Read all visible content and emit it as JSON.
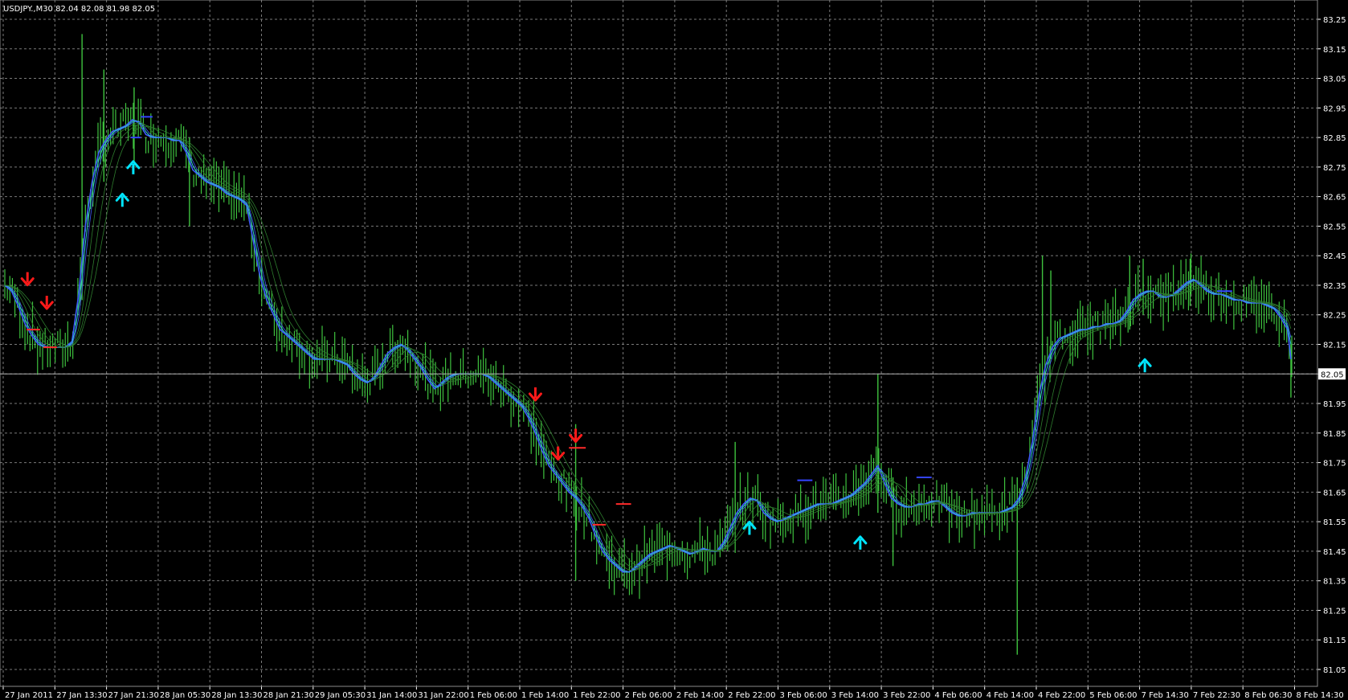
{
  "window": {
    "symbol_label": "USDJPY.,M30",
    "ohlc_label": "82.04 82.08 81.98 82.05",
    "current_price_label": "82.05"
  },
  "colors": {
    "background": "#000000",
    "grid": "#7a7a7a",
    "bars": "#3ec23e",
    "ma_blue": "#3f5cff",
    "ma_cyan": "#2fd0d0",
    "ma_green": "#2e7d2e",
    "arrow_up": "#00e5ff",
    "arrow_down": "#ff1a1a",
    "level_red": "#ff2a2a",
    "level_blue": "#3344ff",
    "axis_text": "#ffffff",
    "price_line": "#b0b0b0"
  },
  "price_axis": {
    "ticks": [
      "83.25",
      "83.15",
      "83.05",
      "82.95",
      "82.85",
      "82.75",
      "82.65",
      "82.55",
      "82.45",
      "82.35",
      "82.25",
      "82.15",
      "82.05",
      "81.95",
      "81.85",
      "81.75",
      "81.65",
      "81.55",
      "81.45",
      "81.35",
      "81.25",
      "81.15",
      "81.05"
    ]
  },
  "time_axis": {
    "ticks": [
      "27 Jan 2011",
      "27 Jan 13:30",
      "27 Jan 21:30",
      "28 Jan 05:30",
      "28 Jan 13:30",
      "28 Jan 21:30",
      "29 Jan 05:30",
      "31 Jan 14:00",
      "31 Jan 22:00",
      "1 Feb 06:00",
      "1 Feb 14:00",
      "1 Feb 22:00",
      "2 Feb 06:00",
      "2 Feb 14:00",
      "2 Feb 22:00",
      "3 Feb 06:00",
      "3 Feb 14:00",
      "3 Feb 22:00",
      "4 Feb 06:00",
      "4 Feb 14:00",
      "4 Feb 22:00",
      "5 Feb 06:00",
      "7 Feb 14:30",
      "7 Feb 22:30",
      "8 Feb 06:30",
      "8 Feb 14:30"
    ]
  },
  "chart_data": {
    "type": "bar",
    "title": "USDJPY.,M30",
    "ylim": [
      81.0,
      83.3
    ],
    "current_price": 82.05,
    "series_path": [
      [
        0,
        82.35
      ],
      [
        8,
        82.33
      ],
      [
        16,
        82.28
      ],
      [
        24,
        82.22
      ],
      [
        32,
        82.18
      ],
      [
        40,
        82.15
      ],
      [
        48,
        82.14
      ],
      [
        56,
        82.14
      ],
      [
        64,
        82.14
      ],
      [
        72,
        82.14
      ],
      [
        80,
        82.16
      ],
      [
        88,
        82.32
      ],
      [
        96,
        82.55
      ],
      [
        104,
        82.7
      ],
      [
        112,
        82.8
      ],
      [
        120,
        82.84
      ],
      [
        128,
        82.87
      ],
      [
        136,
        82.88
      ],
      [
        144,
        82.89
      ],
      [
        152,
        82.91
      ],
      [
        160,
        82.9
      ],
      [
        168,
        82.86
      ],
      [
        176,
        82.85
      ],
      [
        184,
        82.85
      ],
      [
        192,
        82.85
      ],
      [
        200,
        82.84
      ],
      [
        208,
        82.84
      ],
      [
        216,
        82.8
      ],
      [
        224,
        82.74
      ],
      [
        232,
        82.72
      ],
      [
        240,
        82.7
      ],
      [
        248,
        82.69
      ],
      [
        256,
        82.68
      ],
      [
        264,
        82.66
      ],
      [
        272,
        82.65
      ],
      [
        280,
        82.64
      ],
      [
        288,
        82.62
      ],
      [
        296,
        82.5
      ],
      [
        304,
        82.38
      ],
      [
        312,
        82.3
      ],
      [
        320,
        82.25
      ],
      [
        328,
        82.2
      ],
      [
        336,
        82.18
      ],
      [
        344,
        82.16
      ],
      [
        352,
        82.14
      ],
      [
        360,
        82.12
      ],
      [
        368,
        82.1
      ],
      [
        376,
        82.1
      ],
      [
        384,
        82.1
      ],
      [
        392,
        82.1
      ],
      [
        400,
        82.09
      ],
      [
        408,
        82.08
      ],
      [
        416,
        82.05
      ],
      [
        424,
        82.03
      ],
      [
        432,
        82.02
      ],
      [
        440,
        82.04
      ],
      [
        448,
        82.08
      ],
      [
        456,
        82.12
      ],
      [
        464,
        82.14
      ],
      [
        472,
        82.15
      ],
      [
        480,
        82.13
      ],
      [
        488,
        82.1
      ],
      [
        496,
        82.07
      ],
      [
        504,
        82.03
      ],
      [
        512,
        82.0
      ],
      [
        520,
        82.02
      ],
      [
        528,
        82.04
      ],
      [
        536,
        82.05
      ],
      [
        544,
        82.05
      ],
      [
        552,
        82.05
      ],
      [
        560,
        82.05
      ],
      [
        568,
        82.05
      ],
      [
        576,
        82.04
      ],
      [
        584,
        82.02
      ],
      [
        592,
        82.0
      ],
      [
        600,
        81.98
      ],
      [
        608,
        81.96
      ],
      [
        616,
        81.94
      ],
      [
        624,
        81.9
      ],
      [
        632,
        81.85
      ],
      [
        640,
        81.79
      ],
      [
        648,
        81.74
      ],
      [
        656,
        81.71
      ],
      [
        664,
        81.68
      ],
      [
        672,
        81.65
      ],
      [
        680,
        81.63
      ],
      [
        688,
        81.6
      ],
      [
        696,
        81.56
      ],
      [
        704,
        81.5
      ],
      [
        712,
        81.45
      ],
      [
        720,
        81.42
      ],
      [
        728,
        81.4
      ],
      [
        736,
        81.38
      ],
      [
        744,
        81.38
      ],
      [
        752,
        81.4
      ],
      [
        760,
        81.42
      ],
      [
        768,
        81.44
      ],
      [
        776,
        81.45
      ],
      [
        784,
        81.46
      ],
      [
        792,
        81.47
      ],
      [
        800,
        81.46
      ],
      [
        808,
        81.45
      ],
      [
        816,
        81.44
      ],
      [
        824,
        81.45
      ],
      [
        832,
        81.46
      ],
      [
        840,
        81.45
      ],
      [
        848,
        81.45
      ],
      [
        856,
        81.48
      ],
      [
        864,
        81.53
      ],
      [
        872,
        81.58
      ],
      [
        880,
        81.61
      ],
      [
        888,
        81.63
      ],
      [
        896,
        81.62
      ],
      [
        904,
        81.58
      ],
      [
        912,
        81.56
      ],
      [
        920,
        81.55
      ],
      [
        928,
        81.56
      ],
      [
        936,
        81.57
      ],
      [
        944,
        81.58
      ],
      [
        952,
        81.59
      ],
      [
        960,
        81.6
      ],
      [
        968,
        81.61
      ],
      [
        976,
        81.61
      ],
      [
        984,
        81.61
      ],
      [
        992,
        81.62
      ],
      [
        1000,
        81.63
      ],
      [
        1008,
        81.64
      ],
      [
        1016,
        81.66
      ],
      [
        1024,
        81.68
      ],
      [
        1032,
        81.71
      ],
      [
        1040,
        81.74
      ],
      [
        1048,
        81.68
      ],
      [
        1056,
        81.63
      ],
      [
        1064,
        81.61
      ],
      [
        1072,
        81.6
      ],
      [
        1080,
        81.6
      ],
      [
        1088,
        81.61
      ],
      [
        1096,
        81.61
      ],
      [
        1104,
        81.62
      ],
      [
        1112,
        81.62
      ],
      [
        1120,
        81.6
      ],
      [
        1128,
        81.58
      ],
      [
        1136,
        81.57
      ],
      [
        1144,
        81.57
      ],
      [
        1152,
        81.58
      ],
      [
        1160,
        81.58
      ],
      [
        1168,
        81.58
      ],
      [
        1176,
        81.58
      ],
      [
        1184,
        81.58
      ],
      [
        1192,
        81.59
      ],
      [
        1200,
        81.6
      ],
      [
        1208,
        81.63
      ],
      [
        1216,
        81.7
      ],
      [
        1224,
        81.82
      ],
      [
        1232,
        81.98
      ],
      [
        1240,
        82.08
      ],
      [
        1248,
        82.14
      ],
      [
        1256,
        82.17
      ],
      [
        1264,
        82.18
      ],
      [
        1272,
        82.19
      ],
      [
        1280,
        82.2
      ],
      [
        1288,
        82.2
      ],
      [
        1296,
        82.21
      ],
      [
        1304,
        82.21
      ],
      [
        1312,
        82.22
      ],
      [
        1320,
        82.22
      ],
      [
        1328,
        82.23
      ],
      [
        1336,
        82.26
      ],
      [
        1344,
        82.3
      ],
      [
        1352,
        82.32
      ],
      [
        1360,
        82.33
      ],
      [
        1368,
        82.33
      ],
      [
        1376,
        82.31
      ],
      [
        1384,
        82.31
      ],
      [
        1392,
        82.32
      ],
      [
        1400,
        82.34
      ],
      [
        1408,
        82.36
      ],
      [
        1416,
        82.37
      ],
      [
        1424,
        82.35
      ],
      [
        1432,
        82.33
      ],
      [
        1440,
        82.32
      ],
      [
        1448,
        82.32
      ],
      [
        1456,
        82.31
      ],
      [
        1464,
        82.3
      ],
      [
        1472,
        82.3
      ],
      [
        1480,
        82.29
      ],
      [
        1488,
        82.29
      ],
      [
        1496,
        82.29
      ],
      [
        1504,
        82.28
      ],
      [
        1512,
        82.27
      ],
      [
        1520,
        82.24
      ],
      [
        1528,
        82.2
      ],
      [
        1534,
        82.05
      ]
    ],
    "spikes": [
      {
        "x": 92,
        "low": 82.3,
        "high": 83.2
      },
      {
        "x": 118,
        "low": 82.7,
        "high": 83.08
      },
      {
        "x": 154,
        "low": 82.75,
        "high": 83.02
      },
      {
        "x": 220,
        "low": 82.55,
        "high": 82.85
      },
      {
        "x": 680,
        "low": 81.35,
        "high": 81.88
      },
      {
        "x": 870,
        "low": 81.55,
        "high": 81.82
      },
      {
        "x": 1040,
        "low": 81.58,
        "high": 82.05
      },
      {
        "x": 1058,
        "low": 81.4,
        "high": 81.7
      },
      {
        "x": 1206,
        "low": 81.1,
        "high": 81.7
      },
      {
        "x": 1236,
        "low": 82.05,
        "high": 82.45
      },
      {
        "x": 1246,
        "low": 82.1,
        "high": 82.4
      },
      {
        "x": 1340,
        "low": 82.2,
        "high": 82.45
      },
      {
        "x": 1356,
        "low": 82.25,
        "high": 82.44
      },
      {
        "x": 1412,
        "low": 82.28,
        "high": 82.44
      },
      {
        "x": 1532,
        "low": 81.97,
        "high": 82.15
      }
    ],
    "arrows_down": [
      {
        "x": 27,
        "price": 82.37
      },
      {
        "x": 50,
        "price": 82.29
      },
      {
        "x": 632,
        "price": 81.98
      },
      {
        "x": 659,
        "price": 81.78
      },
      {
        "x": 680,
        "price": 81.84
      }
    ],
    "arrows_up": [
      {
        "x": 140,
        "price": 82.64
      },
      {
        "x": 153,
        "price": 82.75
      },
      {
        "x": 887,
        "price": 81.53
      },
      {
        "x": 1019,
        "price": 81.48
      },
      {
        "x": 1358,
        "price": 82.08
      }
    ],
    "level_marks_red": [
      {
        "x1": 26,
        "x2": 42,
        "price": 82.2
      },
      {
        "x1": 46,
        "x2": 62,
        "price": 82.14
      },
      {
        "x1": 672,
        "x2": 692,
        "price": 81.8
      },
      {
        "x1": 700,
        "x2": 716,
        "price": 81.54
      },
      {
        "x1": 728,
        "x2": 746,
        "price": 81.61
      }
    ],
    "level_marks_blue": [
      {
        "x1": 150,
        "x2": 162,
        "price": 82.85
      },
      {
        "x1": 162,
        "x2": 176,
        "price": 82.92
      },
      {
        "x1": 944,
        "x2": 962,
        "price": 81.69
      },
      {
        "x1": 1086,
        "x2": 1104,
        "price": 81.7
      },
      {
        "x1": 1444,
        "x2": 1462,
        "price": 82.33
      }
    ]
  }
}
